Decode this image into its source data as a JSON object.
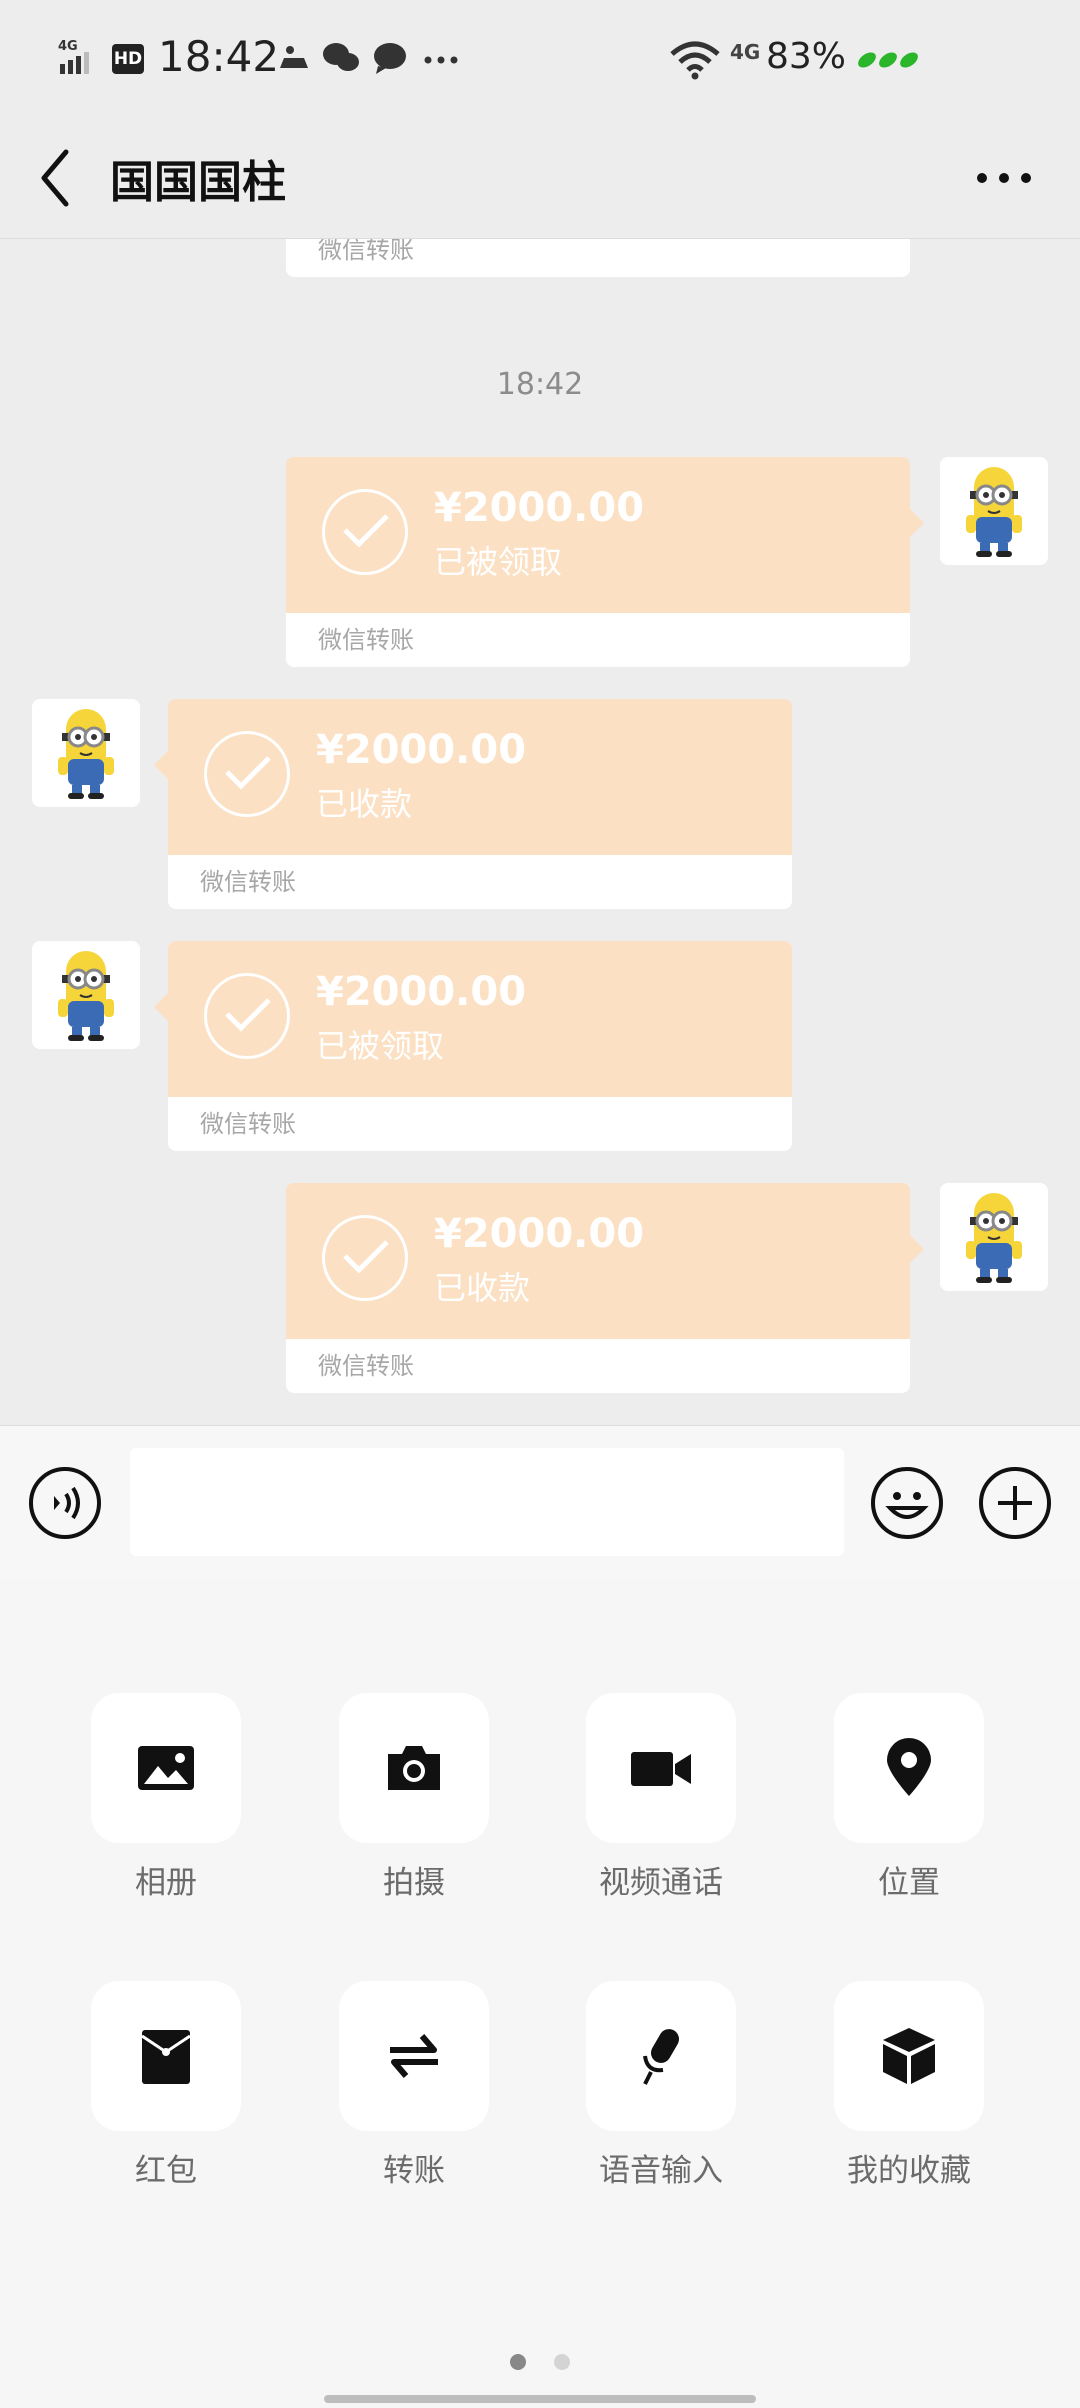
{
  "status_bar": {
    "time": "18:42",
    "hd": "HD",
    "network_left": "4G",
    "network_right": "4G",
    "battery": "83%"
  },
  "header": {
    "title": "国国国柱"
  },
  "chat": {
    "timestamp": "18:42",
    "partial_top_footer": "微信转账",
    "messages": [
      {
        "side": "right",
        "amount": "¥2000.00",
        "state": "已被领取",
        "footer": "微信转账"
      },
      {
        "side": "left",
        "amount": "¥2000.00",
        "state": "已收款",
        "footer": "微信转账"
      },
      {
        "side": "left",
        "amount": "¥2000.00",
        "state": "已被领取",
        "footer": "微信转账"
      },
      {
        "side": "right",
        "amount": "¥2000.00",
        "state": "已收款",
        "footer": "微信转账"
      }
    ]
  },
  "input_bar": {
    "value": ""
  },
  "panel": {
    "tiles": [
      {
        "label": "相册",
        "icon": "photo-icon"
      },
      {
        "label": "拍摄",
        "icon": "camera-icon"
      },
      {
        "label": "视频通话",
        "icon": "video-call-icon"
      },
      {
        "label": "位置",
        "icon": "location-icon"
      },
      {
        "label": "红包",
        "icon": "red-packet-icon"
      },
      {
        "label": "转账",
        "icon": "transfer-icon"
      },
      {
        "label": "语音输入",
        "icon": "voice-input-icon"
      },
      {
        "label": "我的收藏",
        "icon": "favorites-icon"
      }
    ],
    "page_indicator": {
      "pages": 2,
      "current": 1
    }
  },
  "colors": {
    "transfer_bubble": "#fce0c3",
    "background": "#ededed",
    "panel": "#f6f6f6"
  }
}
